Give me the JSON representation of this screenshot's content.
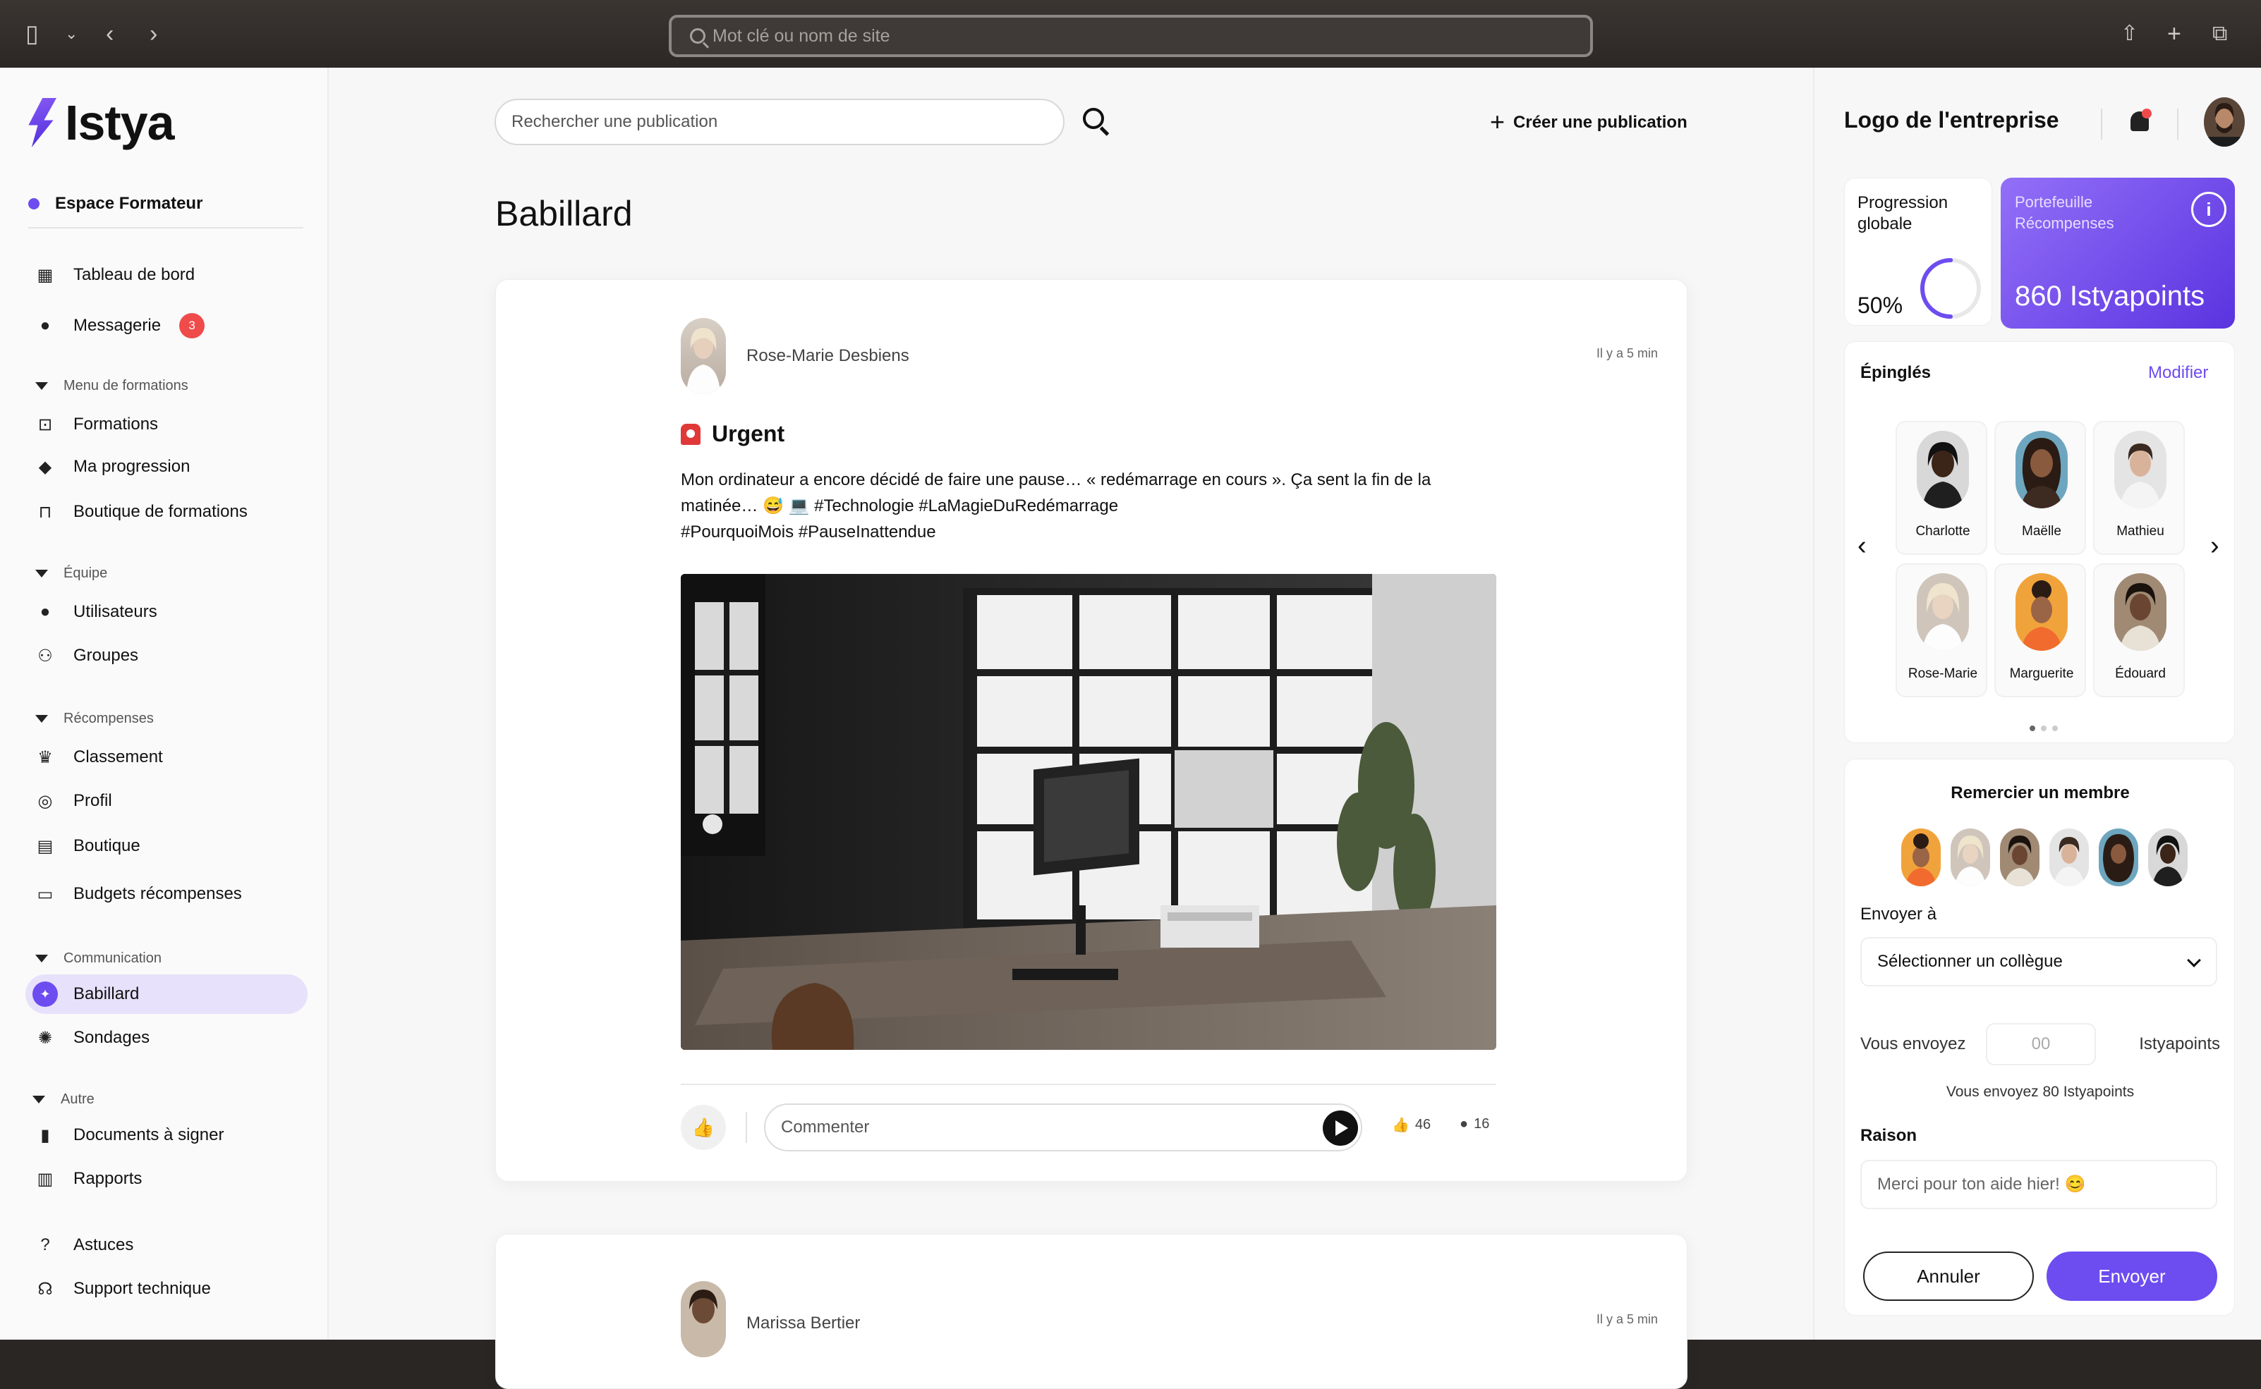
{
  "browser": {
    "url_placeholder": "Mot clé ou nom de site"
  },
  "brand": {
    "name": "Istya",
    "accent": "#6d4cf0"
  },
  "sidebar": {
    "workspace": "Espace Formateur",
    "items": [
      {
        "label": "Tableau de bord"
      },
      {
        "label": "Messagerie",
        "badge": "3"
      }
    ],
    "sections": [
      {
        "title": "Menu de formations",
        "items": [
          "Formations",
          "Ma progression",
          "Boutique de formations"
        ]
      },
      {
        "title": "Équipe",
        "items": [
          "Utilisateurs",
          "Groupes"
        ]
      },
      {
        "title": "Récompenses",
        "items": [
          "Classement",
          "Profil",
          "Boutique",
          "Budgets récompenses"
        ]
      },
      {
        "title": "Communication",
        "items": [
          "Babillard",
          "Sondages"
        ]
      },
      {
        "title": "Autre",
        "items": [
          "Documents à signer",
          "Rapports"
        ]
      }
    ],
    "footer": [
      "Astuces",
      "Support technique"
    ]
  },
  "main": {
    "search_placeholder": "Rechercher une publication",
    "create_label": "Créer une publication",
    "title": "Babillard",
    "posts": [
      {
        "author": "Rose-Marie Desbiens",
        "time": "Il y a 5 min",
        "title": "Urgent",
        "text_line1": "Mon ordinateur a encore décidé de faire une pause… « redémarrage en cours ». Ça sent la fin de la",
        "text_line2": "matinée… 😅 💻  #Technologie #LaMagieDuRedémarrage",
        "text_line3": "#PourquoiMois #PauseInattendue",
        "comment_placeholder": "Commenter",
        "likes": "46",
        "comments": "16"
      },
      {
        "author": "Marissa Bertier",
        "time": "Il y a 5 min"
      }
    ]
  },
  "right": {
    "company_logo": "Logo de l'entreprise",
    "progress": {
      "label_line1": "Progression",
      "label_line2": "globale",
      "value": "50%",
      "fraction": 0.5
    },
    "wallet": {
      "label_line1": "Portefeuille",
      "label_line2": "Récompenses",
      "value": "860 Istyapoints",
      "info": "i"
    },
    "pinned": {
      "title": "Épinglés",
      "edit": "Modifier",
      "people": [
        "Charlotte",
        "Maëlle",
        "Mathieu",
        "Rose-Marie",
        "Marguerite",
        "Édouard"
      ]
    },
    "thanks": {
      "title": "Remercier un membre",
      "send_to": "Envoyer à",
      "select_placeholder": "Sélectionner un collègue",
      "you_send": "Vous envoyez",
      "amount_placeholder": "00",
      "unit": "Istyapoints",
      "summary": "Vous envoyez 80 Istyapoints",
      "reason_label": "Raison",
      "reason_placeholder": "Merci pour ton aide hier! 😊",
      "cancel": "Annuler",
      "submit": "Envoyer"
    }
  }
}
